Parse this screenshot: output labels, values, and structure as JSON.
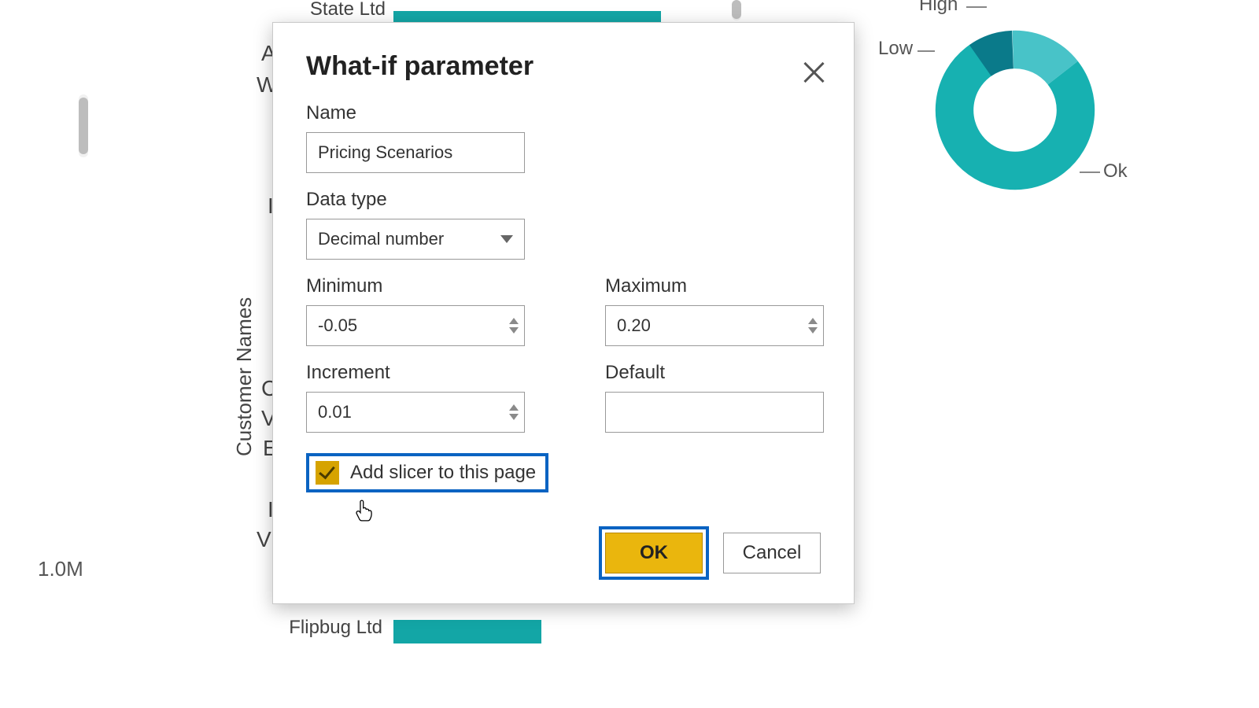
{
  "dialog": {
    "title": "What-if parameter",
    "close_label": "Close",
    "fields": {
      "name_label": "Name",
      "name_value": "Pricing Scenarios",
      "datatype_label": "Data type",
      "datatype_value": "Decimal number",
      "minimum_label": "Minimum",
      "minimum_value": "-0.05",
      "maximum_label": "Maximum",
      "maximum_value": "0.20",
      "increment_label": "Increment",
      "increment_value": "0.01",
      "default_label": "Default",
      "default_value": ""
    },
    "add_slicer_label": "Add slicer to this page",
    "add_slicer_checked": true,
    "ok_label": "OK",
    "cancel_label": "Cancel"
  },
  "background": {
    "axis_title": "Customer Names",
    "tick": "1.0M",
    "row_labels": [
      "State Ltd",
      "Flipbug Ltd"
    ],
    "partial_letters": {
      "l1": "A",
      "l2": "W",
      "l3": "I",
      "l4": "C",
      "l5": "V",
      "l6": "E",
      "l7": "I",
      "l8": "V"
    }
  },
  "donut_labels": {
    "high": "High",
    "low": "Low",
    "ok": "Ok"
  },
  "chart_data": {
    "type": "pie",
    "title": "",
    "series": [
      {
        "name": "Ok",
        "value": 76,
        "color": "#17b1b1"
      },
      {
        "name": "Low",
        "value": 15,
        "color": "#48c3c8"
      },
      {
        "name": "High",
        "value": 9,
        "color": "#0a7a8a"
      }
    ],
    "inner_radius_pct": 55,
    "legend": "outside-callouts"
  },
  "colors": {
    "teal": "#13a6a6",
    "highlight_blue": "#0a63c2",
    "gold": "#eab60d",
    "gold_dark": "#d6a300"
  }
}
